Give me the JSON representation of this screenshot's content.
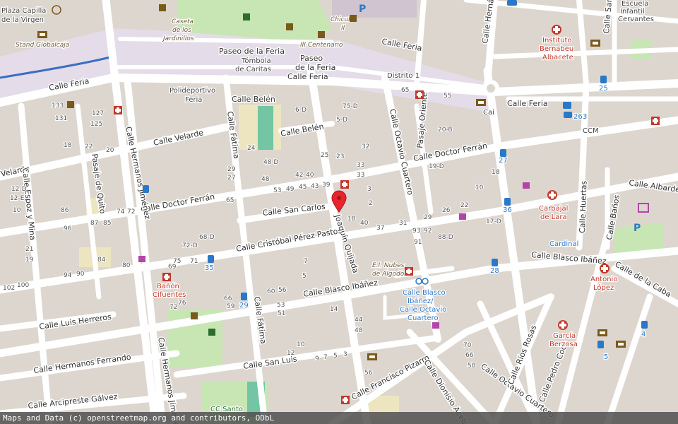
{
  "streets": {
    "calle_feria_w": "Calle Feria",
    "calle_feria_center": "Calle Feria",
    "calle_feria_n": "Calle Feria",
    "calle_feria_e": "Calle Feria",
    "paseo_feria_w": "Paseo de la Feria",
    "paseo_feria_1": "Paseo",
    "paseo_feria_2": "de la Feria",
    "calle_velarde": "Calle Velarde",
    "velarde_w": "Velarde",
    "calle_belen_1": "Calle Belén",
    "calle_belen_2": "Calle Belén",
    "calle_doctor_ferran_w": "Calle Doctor Ferrán",
    "calle_doctor_ferran_e": "Calle Doctor Ferrán",
    "calle_san_carlos": "Calle San Carlos",
    "calle_cristobal": "Calle Cristóbal Pérez Pastor",
    "calle_blasco_w": "Calle Blasco Ibáñez",
    "calle_blasco_e": "Calle Blasco Ibáñez",
    "calle_luis_herreros": "Calle Luis Herreros",
    "calle_hermanos_ferrando": "Calle Hermanos Ferrando",
    "calle_arcipreste": "Calle Arcipreste Gálvez",
    "calle_san_luis": "Calle San Luis",
    "calle_francisco_pizarro": "Calle Francisco Pizarro",
    "calle_dionisio": "Calle Dionisio Acebal",
    "calle_octavio_s": "Calle Octavio Cuartero",
    "calle_octavio_n": "Calle Octavio Cuartero",
    "calle_rios_rosas": "Calle Ríos Rosas",
    "calle_pedro_coca": "Calle Pedro Coca",
    "calle_de_la_caba": "Calle de la Caba",
    "calle_albarder": "Calle Albarder",
    "calle_huertas": "Calle Huertas",
    "calle_banos": "Calle Baños",
    "calle_hermanos_jimenez_n": "Calle Hermanos Jiménez",
    "calle_hermanos_jimenez_s": "Calle Hermanos Jiméne",
    "calle_fatima_n": "Calle Fátima",
    "calle_fatima_s": "Calle Fátima",
    "joaquin_quijada": "Joaquín Quijada",
    "pasaje_quito": "Pasaje de Quito",
    "pasaje_oriente": "Pasaje Oriente",
    "calle_espoz": "Calle Espoz y Mina",
    "calle_herna": "Calle Herná",
    "calle_san": "Calle San",
    "distrito": "Distrito 1"
  },
  "pois": {
    "plaza_capilla_1": "Plaza Capilla",
    "plaza_capilla_2": "de la Virgen",
    "stand": "Stand Globalcaja",
    "caseta_1": "Caseta",
    "caseta_2": "de los",
    "caseta_3": "Jardinillos",
    "chiculo": "Chiculo",
    "chiculo_2": "II",
    "iii_centenario": "III Centenario",
    "tombola_1": "Tómbola",
    "tombola_2": "de Caritas",
    "polideportivo_1": "Polideportivo",
    "polideportivo_2": "Feria",
    "instituto_1": "Instituto",
    "instituto_2": "Bernabeu",
    "instituto_3": "Albacete",
    "escuela_1": "Escuela",
    "escuela_2": "Infantil",
    "escuela_3": "Cervantes",
    "carbajal_1": "Carbajal",
    "carbajal_2": "de Lara",
    "cardinal": "Cardinal",
    "antonio_1": "Antonio",
    "antonio_2": "López",
    "garcia_1": "García",
    "garcia_2": "Berzosa",
    "banon_1": "Bañón",
    "banon_2": "Cifuentes",
    "nubes_1": "E.I. Nubes",
    "nubes_2": "de Algodón",
    "bicing_1": "Calle Blasco",
    "bicing_2": "Ibáñez/",
    "bicing_3": "Calle Octavio",
    "bicing_4": "Cuartero",
    "cc_santo": "CC Santo",
    "cai": "Cai",
    "ccm": "CCM"
  },
  "house_numbers": {
    "n1": "133",
    "n2": "131",
    "n3": "127",
    "n4": "125",
    "n5": "22",
    "n6": "20",
    "n7": "18",
    "n8": "12-D",
    "n9": "12-E",
    "n10": "10",
    "n11": "86",
    "n12": "96",
    "n13": "87",
    "n14": "85",
    "n15": "74",
    "n16": "72",
    "n17": "21",
    "n18": "19",
    "n19": "94",
    "n20": "90",
    "n21": "84",
    "n22": "80",
    "n23": "102",
    "n24": "100",
    "n25": "76",
    "n26": "72",
    "n27": "75-D",
    "n28": "6-D",
    "n29": "5-D",
    "n30": "32",
    "n31": "48 D",
    "n32": "48",
    "n33": "42",
    "n34": "40",
    "n35": "53",
    "n36": "49",
    "n37": "45",
    "n38": "43",
    "n39": "39",
    "n40": "33",
    "n41": "29",
    "n42": "27",
    "n43": "68-D",
    "n44": "72-D",
    "n45": "75",
    "n46": "71",
    "n47": "69",
    "n48": "65",
    "n49": "66",
    "n50": "59",
    "n51": "60",
    "n52": "56",
    "n53": "53",
    "n54": "51",
    "n55": "40",
    "n56": "37",
    "n57": "31",
    "n58": "29",
    "n59": "26",
    "n60": "22",
    "n61": "93",
    "n62": "92",
    "n63": "91",
    "n64": "88-D",
    "n65": "17-D",
    "n66": "19-D",
    "n67": "20-B",
    "n68": "18",
    "n69": "10",
    "n70": "65",
    "n71": "55",
    "n72": "70",
    "n73": "66",
    "n74": "58",
    "n75": "12",
    "n76": "10",
    "n77": "9",
    "n78": "7",
    "n79": "5",
    "n80": "3",
    "n81": "24",
    "n82": "25",
    "n83": "23",
    "n84": "33",
    "n85": "18",
    "n86": "14",
    "n87": "7",
    "n88": "5",
    "n89": "3",
    "n90": "2",
    "n91": "44",
    "n92": "56",
    "n93": "48"
  },
  "bus_stops": {
    "b1": "26",
    "b2": "3",
    "b3": "25",
    "b4": "27",
    "b5": "36",
    "b6": "35",
    "b7": "29",
    "b8": "28",
    "b9": "5",
    "b10": "4"
  },
  "attribution": "Maps and Data (c) openstreetmap.org and contributors, ODbL",
  "colors": {
    "road": "#ffffff",
    "block": "#ddd6cf",
    "park": "#c8e6b4",
    "fair": "#e4dce8",
    "marker": "#e8242c",
    "tram": "#3b6ec2"
  }
}
